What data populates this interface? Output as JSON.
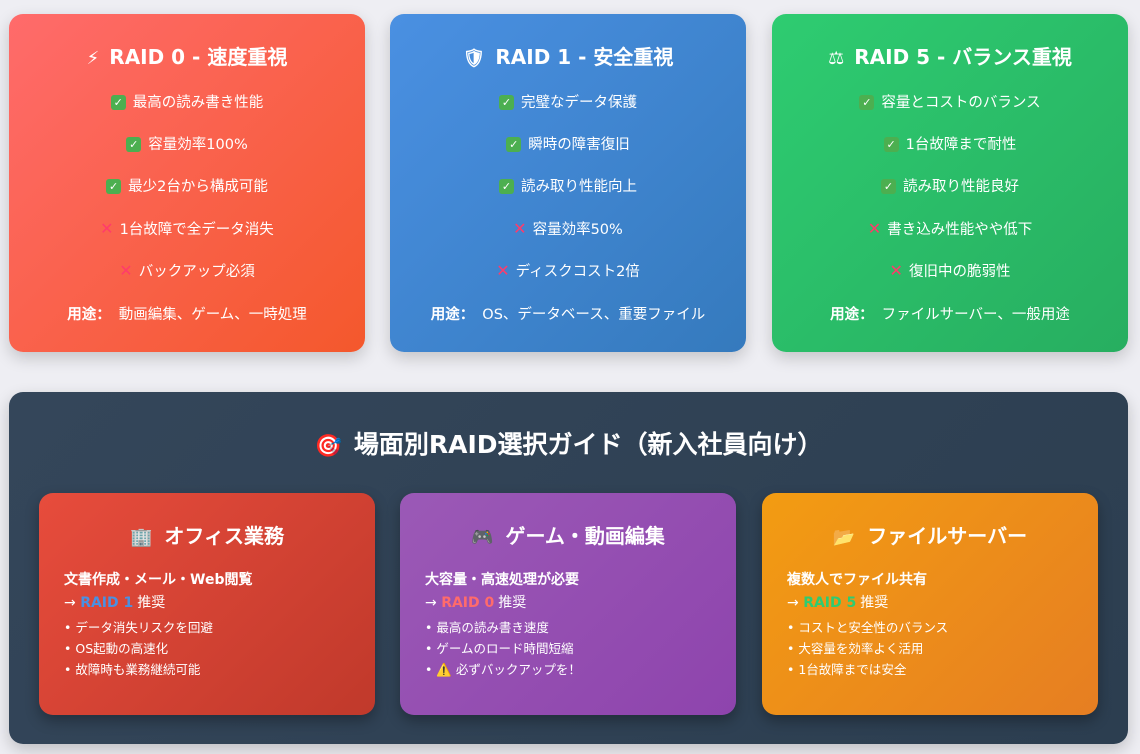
{
  "raid_cards": [
    {
      "icon": "⚡",
      "icon_name": "lightning-icon",
      "title": "RAID 0 - 速度重視",
      "items": [
        {
          "type": "pro",
          "text": "最高の読み書き性能"
        },
        {
          "type": "pro",
          "text": "容量効率100%"
        },
        {
          "type": "pro",
          "text": "最少2台から構成可能"
        },
        {
          "type": "con",
          "text": "1台故障で全データ消失"
        },
        {
          "type": "con",
          "text": "バックアップ必須"
        }
      ],
      "use_label": "用途：",
      "use_text": "動画編集、ゲーム、一時処理"
    },
    {
      "icon": "🛡",
      "icon_name": "shield-icon",
      "title": "RAID 1 - 安全重視",
      "items": [
        {
          "type": "pro",
          "text": "完璧なデータ保護"
        },
        {
          "type": "pro",
          "text": "瞬時の障害復旧"
        },
        {
          "type": "pro",
          "text": "読み取り性能向上"
        },
        {
          "type": "con",
          "text": "容量効率50%"
        },
        {
          "type": "con",
          "text": "ディスクコスト2倍"
        }
      ],
      "use_label": "用途：",
      "use_text": "OS、データベース、重要ファイル"
    },
    {
      "icon": "⚖",
      "icon_name": "balance-scale-icon",
      "title": "RAID 5 - バランス重視",
      "items": [
        {
          "type": "pro",
          "text": "容量とコストのバランス"
        },
        {
          "type": "pro",
          "text": "1台故障まで耐性"
        },
        {
          "type": "pro",
          "text": "読み取り性能良好"
        },
        {
          "type": "con",
          "text": "書き込み性能やや低下"
        },
        {
          "type": "con",
          "text": "復旧中の脆弱性"
        }
      ],
      "use_label": "用途：",
      "use_text": "ファイルサーバー、一般用途"
    }
  ],
  "guide": {
    "icon": "🎯",
    "icon_name": "target-icon",
    "title": "場面別RAID選択ガイド（新入社員向け）",
    "scenarios": [
      {
        "icon": "🏢",
        "icon_name": "office-building-icon",
        "title": "オフィス業務",
        "need": "文書作成・メール・Web閲覧",
        "arrow": "→",
        "level": "RAID 1",
        "level_color": "#4a90e2",
        "recommend": "推奨",
        "points": [
          "データ消失リスクを回避",
          "OS起動の高速化",
          "故障時も業務継続可能"
        ]
      },
      {
        "icon": "🎮",
        "icon_name": "game-controller-icon",
        "title": "ゲーム・動画編集",
        "need": "大容量・高速処理が必要",
        "arrow": "→",
        "level": "RAID 0",
        "level_color": "#ff6b6b",
        "recommend": "推奨",
        "points": [
          "最高の読み書き速度",
          "ゲームのロード時間短縮",
          "⚠️ 必ずバックアップを！"
        ]
      },
      {
        "icon": "📂",
        "icon_name": "folder-icon",
        "title": "ファイルサーバー",
        "need": "複数人でファイル共有",
        "arrow": "→",
        "level": "RAID 5",
        "level_color": "#2ecc71",
        "recommend": "推奨",
        "points": [
          "コストと安全性のバランス",
          "大容量を効率よく活用",
          "1台故障までは安全"
        ]
      }
    ]
  }
}
